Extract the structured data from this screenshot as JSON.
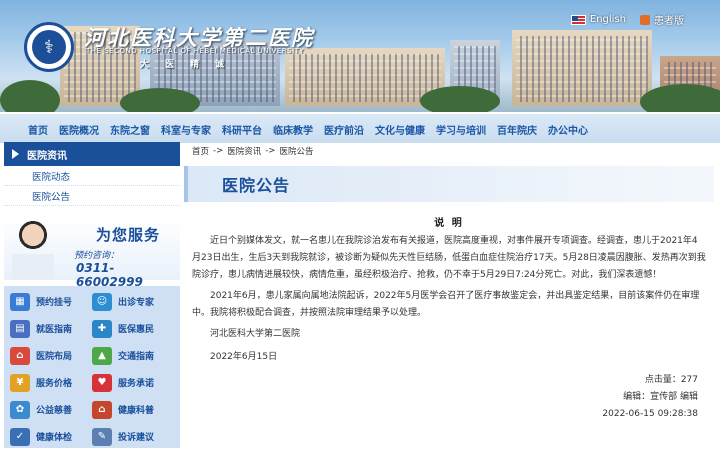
{
  "header": {
    "name_cn": "河北医科大学第二医院",
    "name_en": "THE SECOND HOSPITAL OF HEBEI MEDICAL UNIVERSITY",
    "motto": [
      "大",
      "医",
      "精",
      "诚"
    ],
    "lang_english": "English",
    "lang_patient": "患者版"
  },
  "nav": [
    "首页",
    "医院概况",
    "东院之窗",
    "科室与专家",
    "科研平台",
    "临床教学",
    "医疗前沿",
    "文化与健康",
    "学习与培训",
    "百年院庆",
    "办公中心"
  ],
  "sidebar": {
    "section": "医院资讯",
    "links": [
      "医院动态",
      "医院公告"
    ],
    "serve_title": "为您服务",
    "serve_sub": "预约咨询：",
    "serve_tel": "0311-66002999",
    "services": [
      {
        "label": "预约挂号",
        "icon": "calendar-icon",
        "color": "#3a7bd5"
      },
      {
        "label": "出诊专家",
        "icon": "doctor-icon",
        "color": "#2c8fd1"
      },
      {
        "label": "就医指南",
        "icon": "guide-book-icon",
        "color": "#4a6fc2"
      },
      {
        "label": "医保惠民",
        "icon": "insurance-icon",
        "color": "#2b86c8"
      },
      {
        "label": "医院布局",
        "icon": "map-layout-icon",
        "color": "#d94a3c"
      },
      {
        "label": "交通指南",
        "icon": "traffic-icon",
        "color": "#4ea84a"
      },
      {
        "label": "服务价格",
        "icon": "price-icon",
        "color": "#e0a126"
      },
      {
        "label": "服务承诺",
        "icon": "heart-icon",
        "color": "#d7323a"
      },
      {
        "label": "公益慈善",
        "icon": "charity-icon",
        "color": "#3b8bd0"
      },
      {
        "label": "健康科普",
        "icon": "house-icon",
        "color": "#c4462c"
      },
      {
        "label": "健康体检",
        "icon": "checkup-icon",
        "color": "#3a6fb5"
      },
      {
        "label": "投诉建议",
        "icon": "pen-icon",
        "color": "#5a7fb0"
      }
    ]
  },
  "breadcrumb": [
    "首页",
    "->",
    "医院资讯",
    "->",
    "医院公告"
  ],
  "page_title": "医院公告",
  "article": {
    "title": "说 明",
    "p1": "近日个别媒体发文，就一名患儿在我院诊治发布有关报道，医院高度重视，对事件展开专项调查。经调查，患儿于2021年4月23日出生，生后3天到我院就诊，被诊断为疑似先天性巨结肠，低蛋白血症住院治疗17天。5月28日凌晨因腹胀、发热再次到我院诊疗，患儿病情进展较快，病情危重，虽经积极治疗、抢救，仍不幸于5月29日7:24分死亡。对此，我们深表遗憾！",
    "p2": "2021年6月，患儿家属向属地法院起诉，2022年5月医学会召开了医疗事故鉴定会，并出具鉴定结果，目前该案件仍在审理中。我院将积极配合调查，并按照法院审理结果予以处理。",
    "org": "河北医科大学第二医院",
    "date": "2022年6月15日",
    "hits": "点击量：277",
    "editor": "编辑：宣传部 编辑",
    "timestamp": "2022-06-15 09:28:38"
  }
}
